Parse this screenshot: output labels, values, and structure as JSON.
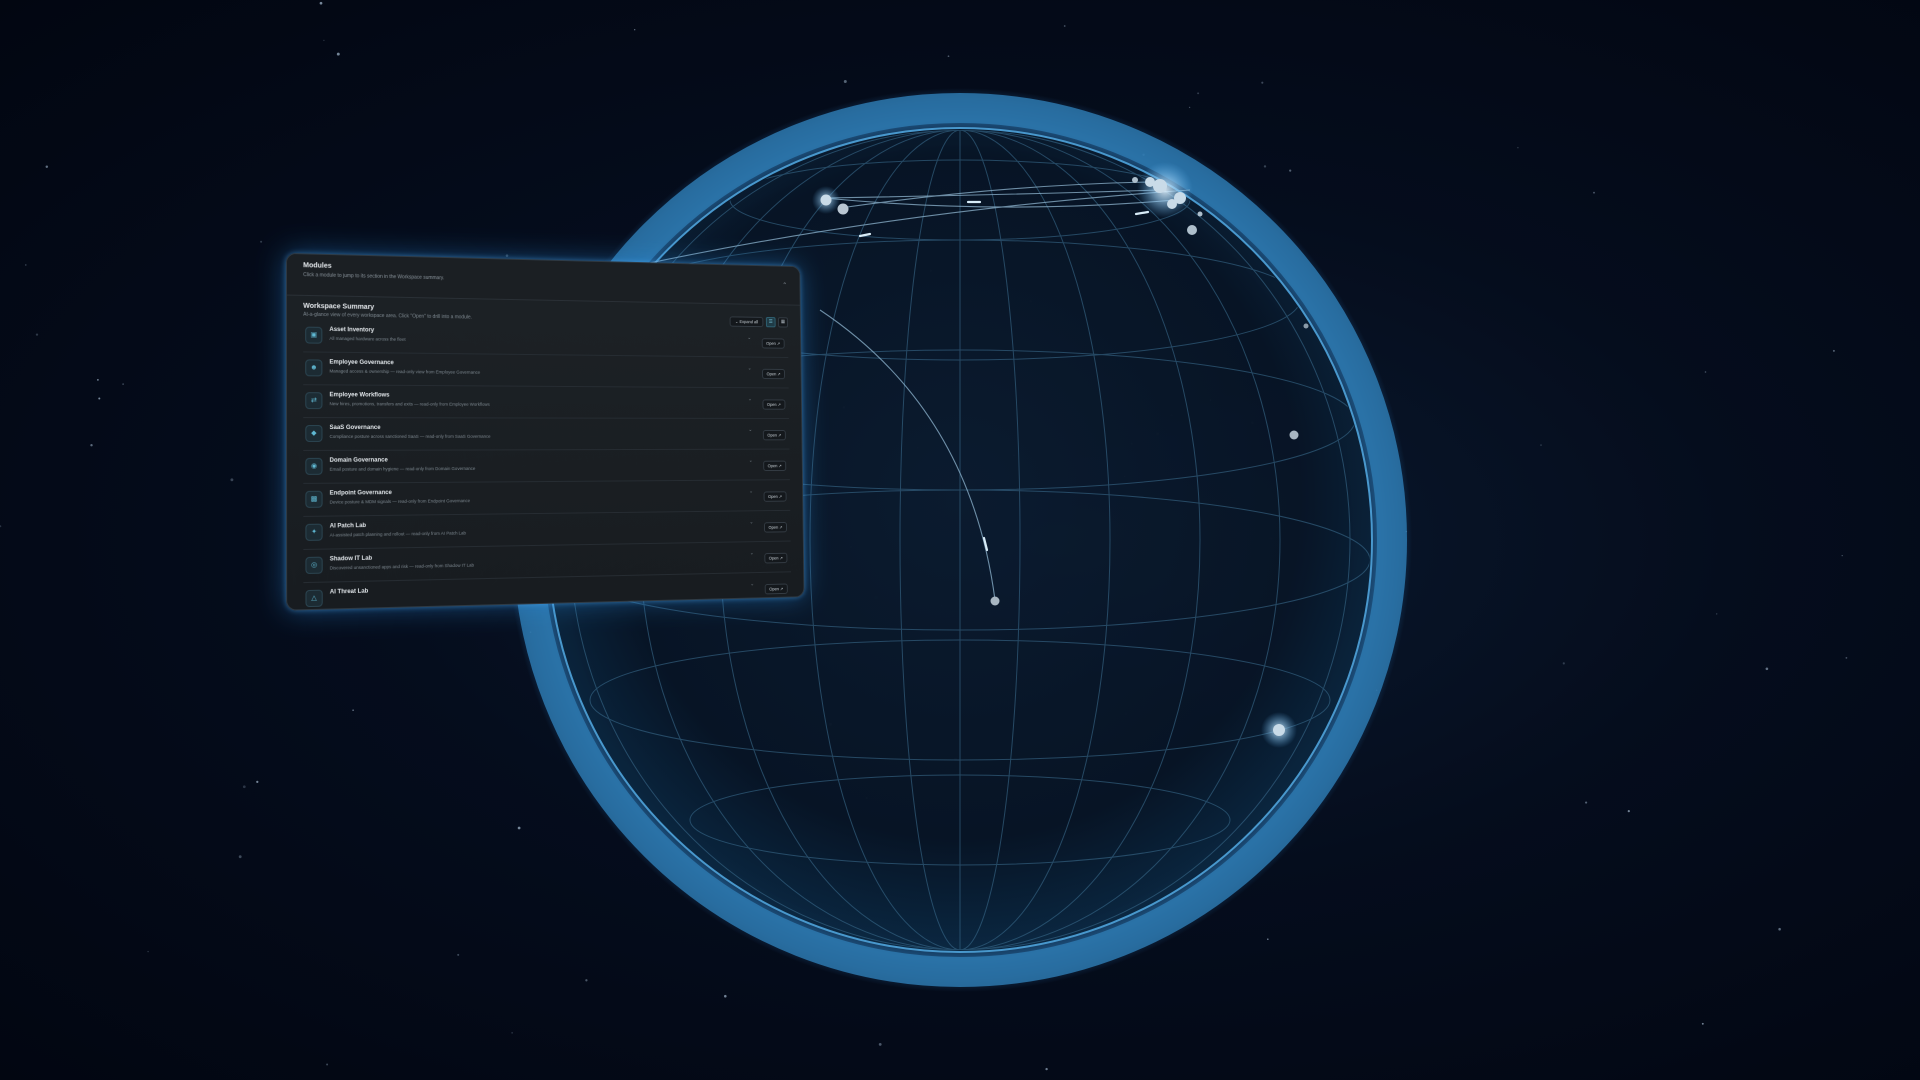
{
  "colors": {
    "background": "#030814",
    "globe_rim": "#2f7fb8",
    "globe_grid": "#3a6b8c",
    "node": "#b9c6d2",
    "panel_bg": "#1b1f23",
    "accent": "#5fb8d2"
  },
  "modules": {
    "title": "Modules",
    "subtitle": "Click a module to jump to its section in the Workspace summary.",
    "collapse_icon": "chevron-up-icon"
  },
  "summary": {
    "title": "Workspace Summary",
    "subtitle": "At-a-glance view of every workspace area. Click \"Open\" to drill into a module.",
    "expand_label": "Expand all",
    "list_view_icon": "list-icon",
    "grid_view_icon": "grid-icon"
  },
  "rows": [
    {
      "title": "Asset Inventory",
      "desc": "All managed hardware across the fleet",
      "open": "Open",
      "icon": "box-icon"
    },
    {
      "title": "Employee Governance",
      "desc": "Managed access & ownership — read-only view from Employee Governance",
      "open": "Open",
      "icon": "users-icon"
    },
    {
      "title": "Employee Workflows",
      "desc": "New hires, promotions, transfers and exits — read-only from Employee Workflows",
      "open": "Open",
      "icon": "workflow-icon"
    },
    {
      "title": "SaaS Governance",
      "desc": "Compliance posture across sanctioned SaaS — read-only from SaaS Governance",
      "open": "Open",
      "icon": "shield-icon"
    },
    {
      "title": "Domain Governance",
      "desc": "Email posture and domain hygiene — read-only from Domain Governance",
      "open": "Open",
      "icon": "globe-icon"
    },
    {
      "title": "Endpoint Governance",
      "desc": "Device posture & MDM signals — read-only from Endpoint Governance",
      "open": "Open",
      "icon": "laptop-icon"
    },
    {
      "title": "AI Patch Lab",
      "desc": "AI-assisted patch planning and rollout — read-only from AI Patch Lab",
      "open": "Open",
      "icon": "wrench-icon"
    },
    {
      "title": "Shadow IT Lab",
      "desc": "Discovered unsanctioned apps and risk — read-only from Shadow IT Lab",
      "open": "Open",
      "icon": "eye-icon"
    },
    {
      "title": "AI Threat Lab",
      "desc": "",
      "open": "Open",
      "icon": "alert-icon"
    }
  ]
}
